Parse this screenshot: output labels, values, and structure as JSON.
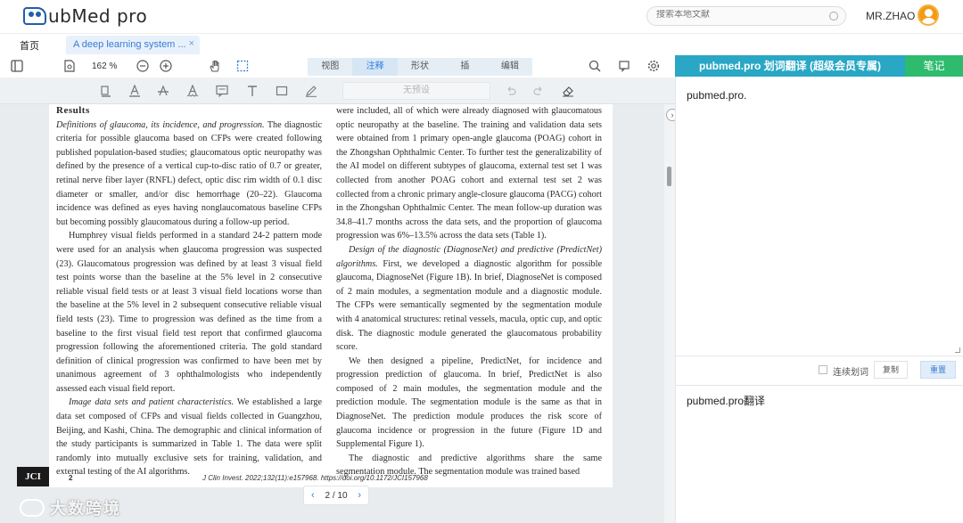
{
  "header": {
    "logo_text": "ubMed pro",
    "search_placeholder": "搜索本地文献",
    "user_name": "MR.ZHAO"
  },
  "tabs": {
    "home": "首页",
    "doc": "A deep learning system ...",
    "close": "×"
  },
  "toolbar": {
    "zoom": "162 %",
    "modes": [
      "视图",
      "注释",
      "形状",
      "插",
      "编辑"
    ],
    "active_mode": "注释",
    "preset_placeholder": "无预设"
  },
  "document": {
    "left_col": {
      "heading": "Results",
      "p1_title": "Definitions of glaucoma, its incidence, and progression.",
      "p1": "The diagnostic criteria for possible glaucoma based on CFPs were created following published population-based studies; glaucomatous optic neuropathy was defined by the presence of a vertical cup-to-disc ratio of 0.7 or greater, retinal nerve fiber layer (RNFL) defect, optic disc rim width of 0.1 disc diameter or smaller, and/or disc hemorrhage (20–22). Glaucoma incidence was defined as eyes having nonglaucomatous baseline CFPs but becoming possibly glaucomatous during a follow-up period.",
      "p2": "Humphrey visual fields performed in a standard 24-2 pattern mode were used for an analysis when glaucoma progression was suspected (23). Glaucomatous progression was defined by at least 3 visual field test points worse than the baseline at the 5% level in 2 consecutive reliable visual field tests or at least 3 visual field locations worse than the baseline at the 5% level in 2 subsequent consecutive reliable visual field tests (23). Time to progression was defined as the time from a baseline to the first visual field test report that confirmed glaucoma progression following the aforementioned criteria. The gold standard definition of clinical progression was confirmed to have been met by unanimous agreement of 3 ophthalmologists who independently assessed each visual field report.",
      "p3_title": "Image data sets and patient characteristics.",
      "p3": "We established a large data set composed of CFPs and visual fields collected in Guangzhou, Beijing, and Kashi, China. The demographic and clinical information of the study participants is summarized in Table 1. The data were split randomly into mutually exclusive sets for training, validation, and external testing of the AI algorithms."
    },
    "right_col": {
      "p1": "were included, all of which were already diagnosed with glaucomatous optic neuropathy at the baseline. The training and validation data sets were obtained from 1 primary open-angle glaucoma (POAG) cohort in the Zhongshan Ophthalmic Center. To further test the generalizability of the AI model on different subtypes of glaucoma, external test set 1 was collected from another POAG cohort and external test set 2 was collected from a chronic primary angle-closure glaucoma (PACG) cohort in the Zhongshan Ophthalmic Center. The mean follow-up duration was 34.8–41.7 months across the data sets, and the proportion of glaucoma progression was 6%–13.5% across the data sets (Table 1).",
      "p2_title": "Design of the diagnostic (DiagnoseNet) and predictive (PredictNet) algorithms.",
      "p2": "First, we developed a diagnostic algorithm for possible glaucoma, DiagnoseNet (Figure 1B). In brief, DiagnoseNet is composed of 2 main modules, a segmentation module and a diagnostic module. The CFPs were semantically segmented by the segmentation module with 4 anatomical structures: retinal vessels, macula, optic cup, and optic disk. The diagnostic module generated the glaucomatous probability score.",
      "p3": "We then designed a pipeline, PredictNet, for incidence and progression prediction of glaucoma. In brief, PredictNet is also composed of 2 main modules, the segmentation module and the prediction module. The segmentation module is the same as that in DiagnoseNet. The prediction module produces the risk score of glaucoma incidence or progression in the future (Figure 1D and Supplemental Figure 1).",
      "p4": "The diagnostic and predictive algorithms share the same segmentation module. The segmentation module was trained based"
    },
    "footer_badge": "JCI",
    "footer_page": "2",
    "footer_cite": "J Clin Invest. 2022;132(11):e157968. https://doi.org/10.1172/JCI157968"
  },
  "pager": {
    "prev": "‹",
    "label": "2 / 10",
    "next": "›"
  },
  "watermark": "大数跨境",
  "panel": {
    "title": "pubmed.pro 划词翻译 (超级会员专属)",
    "notes": "笔记",
    "source_text": "pubmed.pro.",
    "continuous_label": "连续划词",
    "copy_label": "复制",
    "reset_label": "重置",
    "translation": "pubmed.pro翻译"
  },
  "colors": {
    "accent": "#29a7c5",
    "notes_green": "#2fbb6e",
    "link_blue": "#2f7de1"
  }
}
